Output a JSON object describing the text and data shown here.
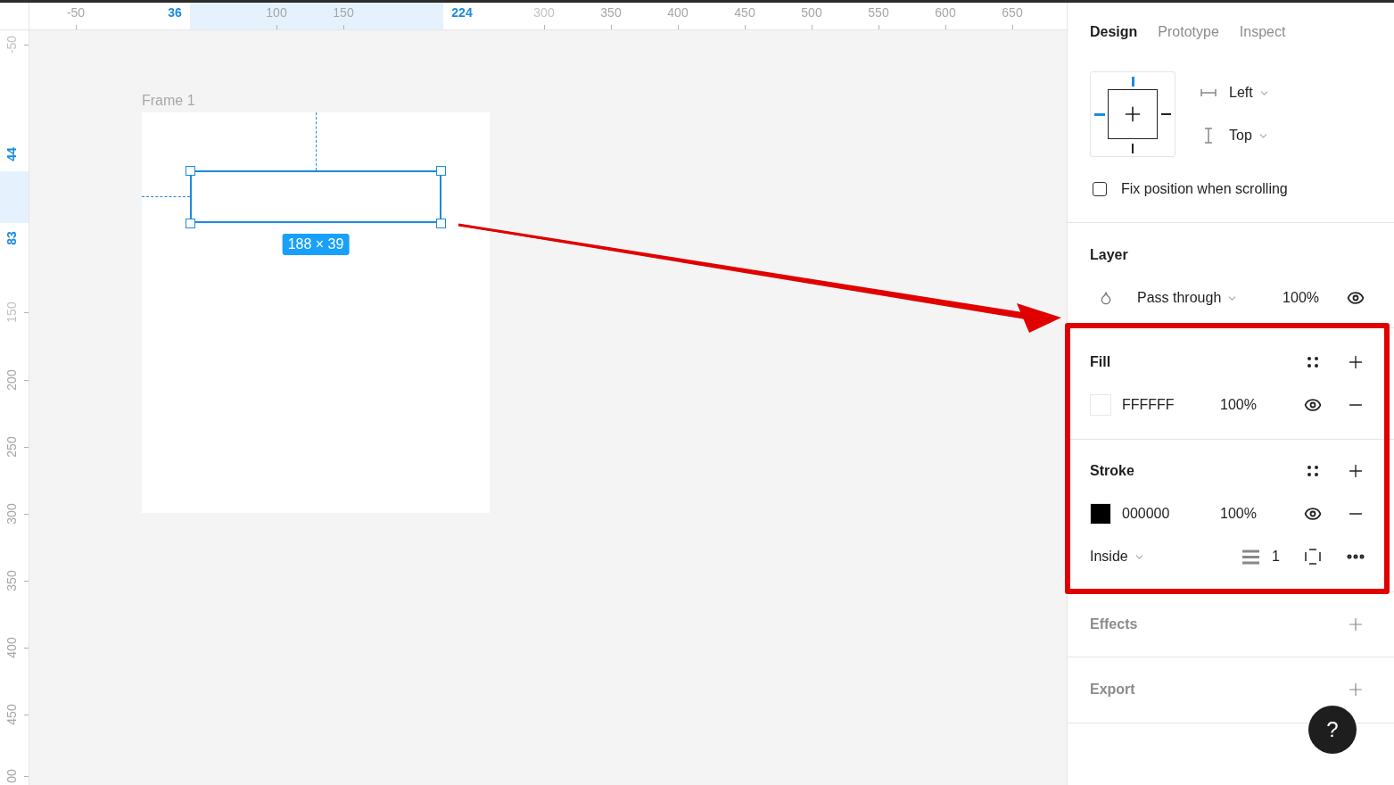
{
  "rulers": {
    "top": [
      {
        "label": "-50",
        "kind": "normal"
      },
      {
        "label": "36",
        "kind": "selected"
      },
      {
        "label": "100",
        "kind": "normal"
      },
      {
        "label": "150",
        "kind": "normal"
      },
      {
        "label": "224",
        "kind": "selected"
      },
      {
        "label": "300",
        "kind": "faded"
      },
      {
        "label": "350",
        "kind": "normal"
      },
      {
        "label": "400",
        "kind": "normal"
      },
      {
        "label": "450",
        "kind": "normal"
      },
      {
        "label": "500",
        "kind": "normal"
      },
      {
        "label": "550",
        "kind": "normal"
      },
      {
        "label": "600",
        "kind": "normal"
      },
      {
        "label": "650",
        "kind": "normal"
      }
    ],
    "left": [
      {
        "label": "-50",
        "kind": "faded"
      },
      {
        "label": "44",
        "kind": "selected"
      },
      {
        "label": "83",
        "kind": "selected"
      },
      {
        "label": "150",
        "kind": "faded"
      },
      {
        "label": "200",
        "kind": "normal"
      },
      {
        "label": "250",
        "kind": "normal"
      },
      {
        "label": "300",
        "kind": "normal"
      },
      {
        "label": "350",
        "kind": "normal"
      },
      {
        "label": "400",
        "kind": "normal"
      },
      {
        "label": "450",
        "kind": "normal"
      },
      {
        "label": "00",
        "kind": "normal"
      }
    ]
  },
  "canvas": {
    "frame": {
      "name": "Frame 1"
    },
    "selection": {
      "size": "188 × 39"
    }
  },
  "panel": {
    "tabs": [
      {
        "label": "Design",
        "selected": true
      },
      {
        "label": "Prototype",
        "selected": false
      },
      {
        "label": "Inspect",
        "selected": false
      }
    ],
    "constraints": {
      "pins": {
        "top": true,
        "left": true,
        "right": false,
        "bottom": false
      },
      "horizontal": "Left",
      "vertical": "Top"
    },
    "fix_position": {
      "label": "Fix position when scrolling",
      "checked": false
    },
    "layer": {
      "title": "Layer",
      "blend": "Pass through",
      "opacity": "100%",
      "visible": true
    },
    "fill": {
      "title": "Fill",
      "items": [
        {
          "hex": "FFFFFF",
          "color": "#ffffff",
          "opacity": "100%",
          "visible": true
        }
      ]
    },
    "stroke": {
      "title": "Stroke",
      "items": [
        {
          "hex": "000000",
          "color": "#000000",
          "opacity": "100%",
          "visible": true
        }
      ],
      "position": "Inside",
      "weight": "1"
    },
    "effects": {
      "title": "Effects"
    },
    "export": {
      "title": "Export"
    }
  },
  "help_button": {
    "label": "?"
  }
}
